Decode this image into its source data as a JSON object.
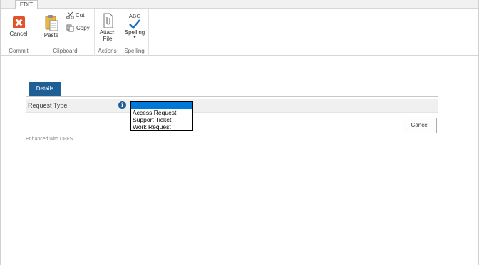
{
  "ribbon": {
    "active_tab": "EDIT",
    "groups": {
      "commit": {
        "label": "Commit",
        "cancel_label": "Cancel"
      },
      "clipboard": {
        "label": "Clipboard",
        "paste_label": "Paste",
        "cut_label": "Cut",
        "copy_label": "Copy"
      },
      "actions": {
        "label": "Actions",
        "attach_line1": "Attach",
        "attach_line2": "File"
      },
      "spelling": {
        "label": "Spelling",
        "icon_text": "ABC",
        "spelling_label": "Spelling"
      }
    }
  },
  "form": {
    "tab_label": "Details",
    "field_label": "Request Type",
    "dropdown": {
      "selected": "",
      "options": [
        "Access Request",
        "Support Ticket",
        "Work Request"
      ]
    },
    "cancel_label": "Cancel",
    "footer_note": "Enhanced with DFFS"
  },
  "colors": {
    "accent": "#1e5f96",
    "cancel_icon": "#e0532d",
    "selection": "#0078d7"
  },
  "icons": [
    "cancel-icon",
    "paste-icon",
    "cut-icon",
    "copy-icon",
    "attach-file-icon",
    "spelling-check-icon",
    "info-icon",
    "dropdown-arrow-icon"
  ]
}
